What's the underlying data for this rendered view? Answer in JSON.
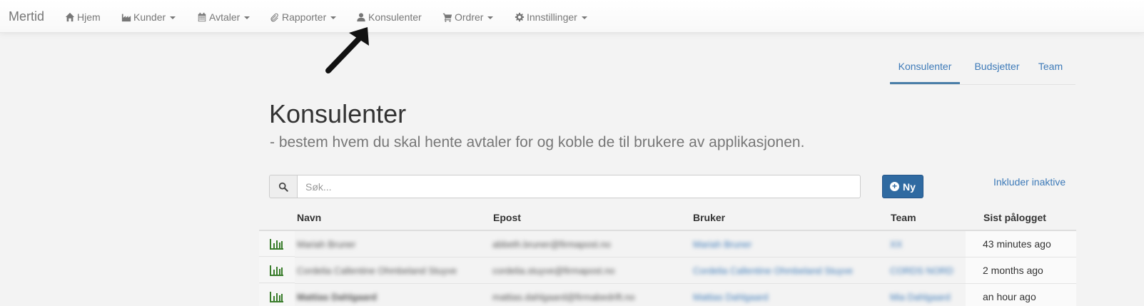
{
  "app": {
    "brand": "Mertid"
  },
  "nav": [
    {
      "label": "Hjem",
      "icon": "home-icon",
      "dropdown": false
    },
    {
      "label": "Kunder",
      "icon": "industry-icon",
      "dropdown": true
    },
    {
      "label": "Avtaler",
      "icon": "calendar-icon",
      "dropdown": true
    },
    {
      "label": "Rapporter",
      "icon": "paperclip-icon",
      "dropdown": true
    },
    {
      "label": "Konsulenter",
      "icon": "user-icon",
      "dropdown": false
    },
    {
      "label": "Ordrer",
      "icon": "cart-icon",
      "dropdown": true
    },
    {
      "label": "Innstillinger",
      "icon": "gear-icon",
      "dropdown": true
    }
  ],
  "subtabs": [
    {
      "label": "Konsulenter",
      "active": true
    },
    {
      "label": "Budsjetter",
      "active": false
    },
    {
      "label": "Team",
      "active": false
    }
  ],
  "page": {
    "title": "Konsulenter",
    "subtitle": "- bestem hvem du skal hente avtaler for og koble de til brukere av applikasjonen."
  },
  "search": {
    "placeholder": "Søk...",
    "value": ""
  },
  "buttons": {
    "new_label": "Ny",
    "include_inactive": "Inkluder inaktive"
  },
  "table": {
    "headers": [
      "Navn",
      "Epost",
      "Bruker",
      "Team",
      "Sist pålogget"
    ],
    "rows": [
      {
        "name": "Mariah Bruner",
        "email": "abbeth.bruner@firmapost.no",
        "user": "Mariah Bruner",
        "team": "XX",
        "last_login": "43 minutes ago"
      },
      {
        "name": "Cordelia Callentine Ohmbeland Stuyve",
        "email": "cordelia.stuyve@firmapost.no",
        "user": "Cordelia Callentine Ohmbeland Stuyve",
        "team": "CORDS NORD",
        "last_login": "2 months ago"
      },
      {
        "name": "Mattias Dahlgaard",
        "email": "mattias.dahlgaard@firmabedrift.no",
        "user": "Mattias Dahlgaard",
        "team": "Mia Dahlgaard",
        "last_login": "an hour ago"
      }
    ]
  },
  "colors": {
    "accent": "#3d7ab8",
    "primary_button": "#2f6aa1",
    "chart_icon": "#3a7d2c"
  }
}
